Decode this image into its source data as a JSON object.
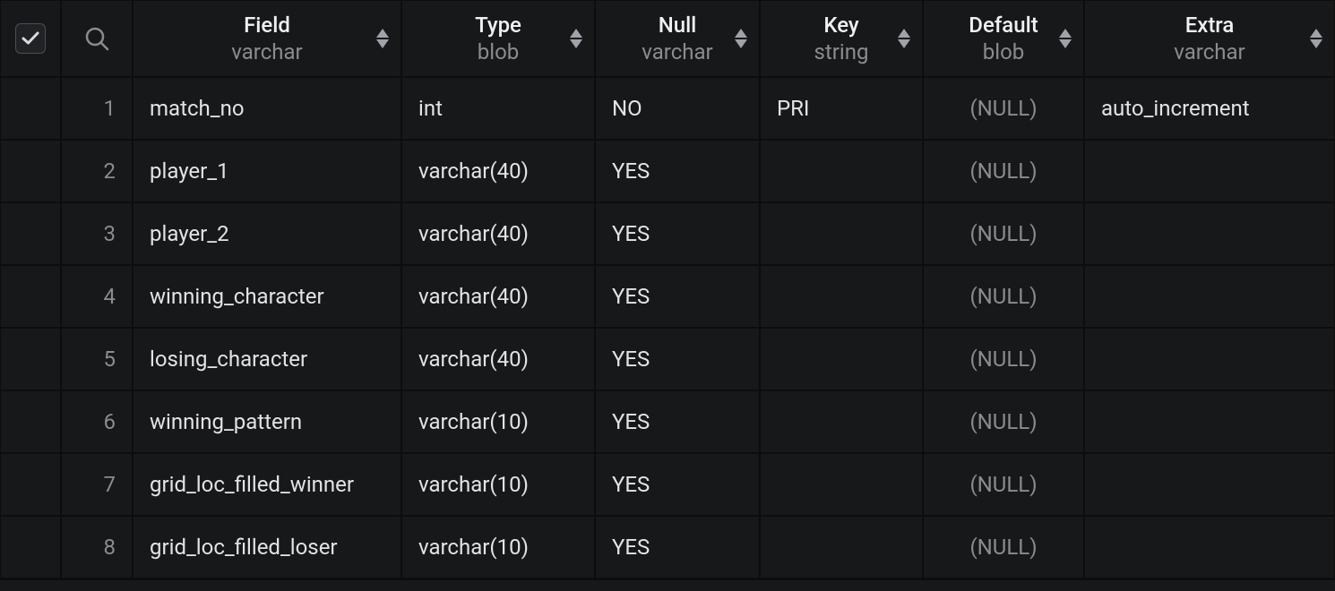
{
  "columns": [
    {
      "key": "field",
      "title": "Field",
      "subtype": "varchar",
      "width_class": "w-field"
    },
    {
      "key": "type",
      "title": "Type",
      "subtype": "blob",
      "width_class": "w-type"
    },
    {
      "key": "null",
      "title": "Null",
      "subtype": "varchar",
      "width_class": "w-null"
    },
    {
      "key": "key_",
      "title": "Key",
      "subtype": "string",
      "width_class": "w-key"
    },
    {
      "key": "default",
      "title": "Default",
      "subtype": "blob",
      "width_class": "w-default"
    },
    {
      "key": "extra",
      "title": "Extra",
      "subtype": "varchar",
      "width_class": "w-extra"
    }
  ],
  "null_label": "(NULL)",
  "rows": [
    {
      "num": "1",
      "field": "match_no",
      "type": "int",
      "null": "NO",
      "key_": "PRI",
      "default": null,
      "extra": "auto_increment"
    },
    {
      "num": "2",
      "field": "player_1",
      "type": "varchar(40)",
      "null": "YES",
      "key_": "",
      "default": null,
      "extra": ""
    },
    {
      "num": "3",
      "field": "player_2",
      "type": "varchar(40)",
      "null": "YES",
      "key_": "",
      "default": null,
      "extra": ""
    },
    {
      "num": "4",
      "field": "winning_character",
      "type": "varchar(40)",
      "null": "YES",
      "key_": "",
      "default": null,
      "extra": ""
    },
    {
      "num": "5",
      "field": "losing_character",
      "type": "varchar(40)",
      "null": "YES",
      "key_": "",
      "default": null,
      "extra": ""
    },
    {
      "num": "6",
      "field": "winning_pattern",
      "type": "varchar(10)",
      "null": "YES",
      "key_": "",
      "default": null,
      "extra": ""
    },
    {
      "num": "7",
      "field": "grid_loc_filled_winner",
      "type": "varchar(10)",
      "null": "YES",
      "key_": "",
      "default": null,
      "extra": ""
    },
    {
      "num": "8",
      "field": "grid_loc_filled_loser",
      "type": "varchar(10)",
      "null": "YES",
      "key_": "",
      "default": null,
      "extra": ""
    }
  ]
}
